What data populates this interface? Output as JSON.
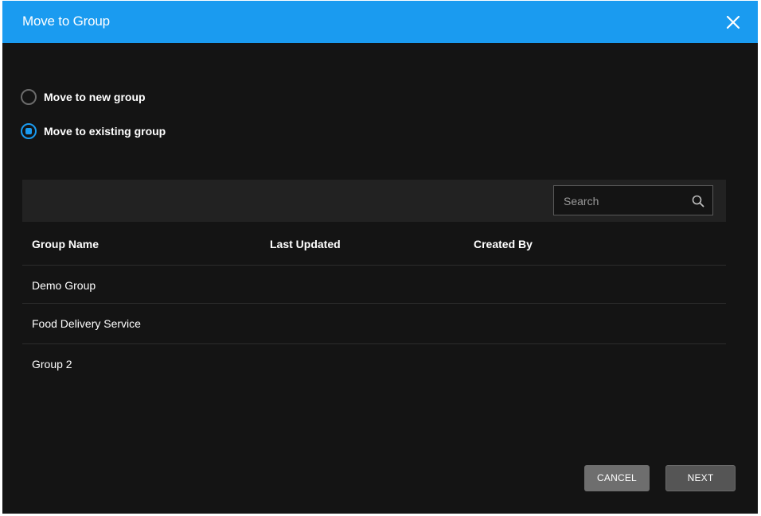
{
  "dialog": {
    "title": "Move to Group",
    "close_icon": "close-icon"
  },
  "options": {
    "new_group": {
      "label": "Move to new group",
      "selected": false
    },
    "existing_group": {
      "label": "Move to existing group",
      "selected": true
    }
  },
  "search": {
    "placeholder": "Search",
    "value": "",
    "icon": "search-icon"
  },
  "table": {
    "columns": [
      "Group Name",
      "Last Updated",
      "Created By"
    ],
    "rows": [
      {
        "group_name": "Demo Group",
        "last_updated": "",
        "created_by": ""
      },
      {
        "group_name": "Food Delivery Service",
        "last_updated": "",
        "created_by": ""
      },
      {
        "group_name": "Group 2",
        "last_updated": "",
        "created_by": ""
      }
    ]
  },
  "footer": {
    "cancel_label": "CANCEL",
    "next_label": "NEXT"
  },
  "colors": {
    "accent": "#1a9bf0",
    "background": "#141414",
    "toolbar": "#222222"
  }
}
